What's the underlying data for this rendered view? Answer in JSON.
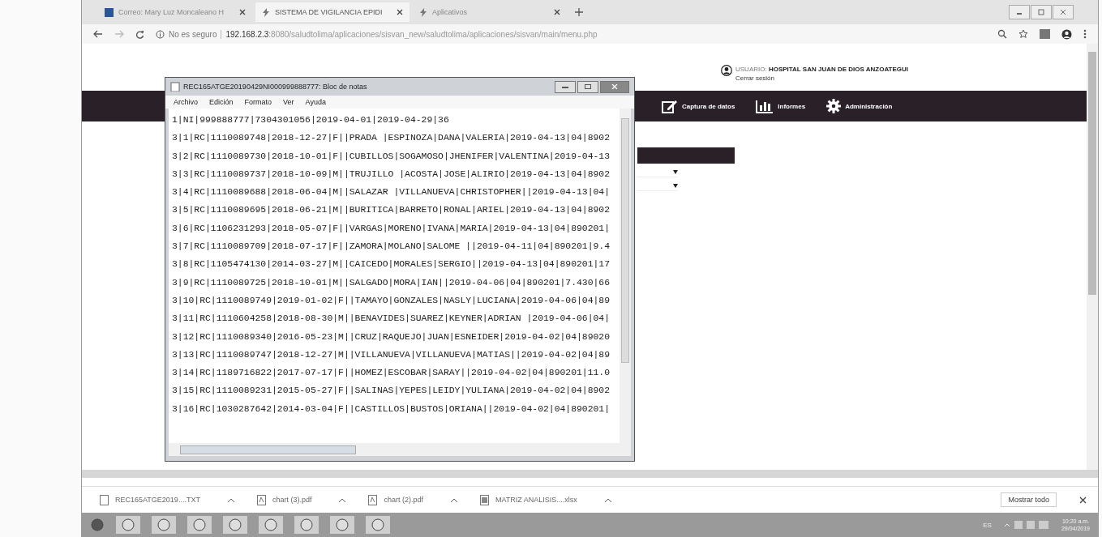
{
  "browser": {
    "tabs": [
      {
        "label": "Correo: Mary Luz Moncaleano H",
        "selected": false
      },
      {
        "label": "SISTEMA DE VIGILANCIA EPIDI",
        "selected": true
      },
      {
        "label": "Aplicativos",
        "selected": false
      }
    ],
    "address": {
      "security": "No es seguro",
      "host": "192.168.2.3",
      "path": ":8080/saludtolima/aplicaciones/sisvan_new/saludtolima/aplicaciones/sisvan/main/menu.php"
    }
  },
  "page": {
    "user_label": "USUARIO:",
    "user_name": "HOSPITAL SAN JUAN DE DIOS ANZOATEGUI",
    "logout": "Cerrar sesión",
    "nav": [
      {
        "label": "Captura de datos",
        "kind": "edit"
      },
      {
        "label": "Informes",
        "kind": "chart"
      },
      {
        "label": "Administración",
        "kind": "gear"
      }
    ]
  },
  "notepad": {
    "title": "REC165ATGE20190429NI000999888777: Bloc de notas",
    "menu": [
      "Archivo",
      "Edición",
      "Formato",
      "Ver",
      "Ayuda"
    ],
    "lines": [
      "1|NI|999888777|7304301056|2019-04-01|2019-04-29|36",
      "3|1|RC|1110089748|2018-12-27|F||PRADA |ESPINOZA|DANA|VALERIA|2019-04-13|04|8902",
      "3|2|RC|1110089730|2018-10-01|F||CUBILLOS|SOGAMOSO|JHENIFER|VALENTINA|2019-04-13",
      "3|3|RC|1110089737|2018-10-09|M||TRUJILLO |ACOSTA|JOSE|ALIRIO|2019-04-13|04|8902",
      "3|4|RC|1110089688|2018-06-04|M||SALAZAR |VILLANUEVA|CHRISTOPHER||2019-04-13|04|",
      "3|5|RC|1110089695|2018-06-21|M||BURITICA|BARRETO|RONAL|ARIEL|2019-04-13|04|8902",
      "3|6|RC|1106231293|2018-05-07|F||VARGAS|MORENO|IVANA|MARIA|2019-04-13|04|890201|",
      "3|7|RC|1110089709|2018-07-17|F||ZAMORA|MOLANO|SALOME ||2019-04-11|04|890201|9.4",
      "3|8|RC|1105474130|2014-03-27|M||CAICEDO|MORALES|SERGIO||2019-04-13|04|890201|17",
      "3|9|RC|1110089725|2018-10-01|M||SALGADO|MORA|IAN||2019-04-06|04|890201|7.430|66",
      "3|10|RC|1110089749|2019-01-02|F||TAMAYO|GONZALES|NASLY|LUCIANA|2019-04-06|04|89",
      "3|11|RC|1110604258|2018-08-30|M||BENAVIDES|SUAREZ|KEYNER|ADRIAN |2019-04-06|04|",
      "3|12|RC|1110089340|2016-05-23|M||CRUZ|RAQUEJO|JUAN|ESNEIDER|2019-04-02|04|89020",
      "3|13|RC|1110089747|2018-12-27|M||VILLANUEVA|VILLANUEVA|MATIAS||2019-04-02|04|89",
      "3|14|RC|1189716822|2017-07-17|F||HOMEZ|ESCOBAR|SARAY||2019-04-02|04|890201|11.0",
      "3|15|RC|1110089231|2015-05-27|F||SALINAS|YEPES|LEIDY|YULIANA|2019-04-02|04|8902",
      "3|16|RC|1030287642|2014-03-04|F||CASTILLOS|BUSTOS|ORIANA||2019-04-02|04|890201|"
    ]
  },
  "downloads": {
    "items": [
      {
        "name": "REC165ATGE2019....TXT",
        "kind": "txt"
      },
      {
        "name": "chart (3).pdf",
        "kind": "pdf"
      },
      {
        "name": "chart (2).pdf",
        "kind": "pdf"
      },
      {
        "name": "MATRIZ ANALISIS....xlsx",
        "kind": "xlsx"
      }
    ],
    "show_all": "Mostrar todo"
  },
  "taskbar": {
    "language": "ES",
    "time": "10:20 a.m.",
    "date": "29/04/2019"
  }
}
